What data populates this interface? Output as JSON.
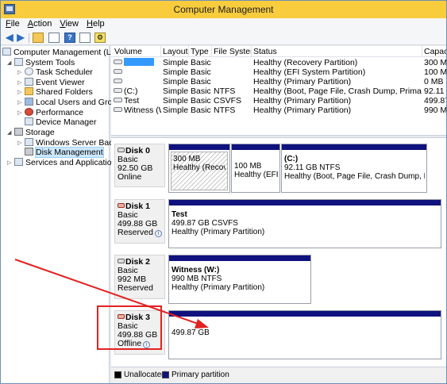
{
  "window": {
    "title": "Computer Management"
  },
  "menu": [
    "File",
    "Action",
    "View",
    "Help"
  ],
  "tree": {
    "root": "Computer Management (Local",
    "system_tools": "System Tools",
    "items": [
      "Task Scheduler",
      "Event Viewer",
      "Shared Folders",
      "Local Users and Groups",
      "Performance",
      "Device Manager"
    ],
    "storage": "Storage",
    "storage_items": [
      "Windows Server Backup",
      "Disk Management"
    ],
    "services": "Services and Applications"
  },
  "volume_list": {
    "columns": [
      "Volume",
      "Layout",
      "Type",
      "File System",
      "Status",
      "Capac"
    ],
    "rows": [
      {
        "volume": "",
        "layout": "Simple",
        "type": "Basic",
        "fs": "",
        "status": "Healthy (Recovery Partition)",
        "capacity": "300 M"
      },
      {
        "volume": "",
        "layout": "Simple",
        "type": "Basic",
        "fs": "",
        "status": "Healthy (EFI System Partition)",
        "capacity": "100 M"
      },
      {
        "volume": "",
        "layout": "Simple",
        "type": "Basic",
        "fs": "",
        "status": "Healthy (Primary Partition)",
        "capacity": "0 MB"
      },
      {
        "volume": "(C:)",
        "layout": "Simple",
        "type": "Basic",
        "fs": "NTFS",
        "status": "Healthy (Boot, Page File, Crash Dump, Primary Partition)",
        "capacity": "92.11"
      },
      {
        "volume": "Test",
        "layout": "Simple",
        "type": "Basic",
        "fs": "CSVFS",
        "status": "Healthy (Primary Partition)",
        "capacity": "499.87"
      },
      {
        "volume": "Witness (W:)",
        "layout": "Simple",
        "type": "Basic",
        "fs": "NTFS",
        "status": "Healthy (Primary Partition)",
        "capacity": "990 M"
      }
    ]
  },
  "disks": [
    {
      "name": "Disk 0",
      "type": "Basic",
      "size": "92.50 GB",
      "state": "Online",
      "partitions": [
        {
          "title": "",
          "size": "300 MB",
          "status": "Healthy (Recovery"
        },
        {
          "title": "",
          "size": "100 MB",
          "status": "Healthy (EFI Sy"
        },
        {
          "title": "(C:)",
          "size": "92.11 GB NTFS",
          "status": "Healthy (Boot, Page File, Crash Dump, P"
        }
      ]
    },
    {
      "name": "Disk 1",
      "type": "Basic",
      "size": "499.88 GB",
      "state": "Reserved",
      "partitions": [
        {
          "title": "Test",
          "size": "499.87 GB CSVFS",
          "status": "Healthy (Primary Partition)"
        }
      ]
    },
    {
      "name": "Disk 2",
      "type": "Basic",
      "size": "992 MB",
      "state": "Reserved",
      "partitions": [
        {
          "title": "Witness  (W:)",
          "size": "990 MB NTFS",
          "status": "Healthy (Primary Partition)"
        }
      ]
    },
    {
      "name": "Disk 3",
      "type": "Basic",
      "size": "499.88 GB",
      "state": "Offline",
      "partitions": [
        {
          "title": "",
          "size": "499.87 GB",
          "status": ""
        }
      ]
    }
  ],
  "legend": {
    "unallocated": "Unallocated",
    "primary": "Primary partition"
  },
  "colors": {
    "title_bar": "#f8cc3d",
    "partition_bar": "#10127e",
    "annotation": "#e32222",
    "selection": "#3399ff"
  }
}
